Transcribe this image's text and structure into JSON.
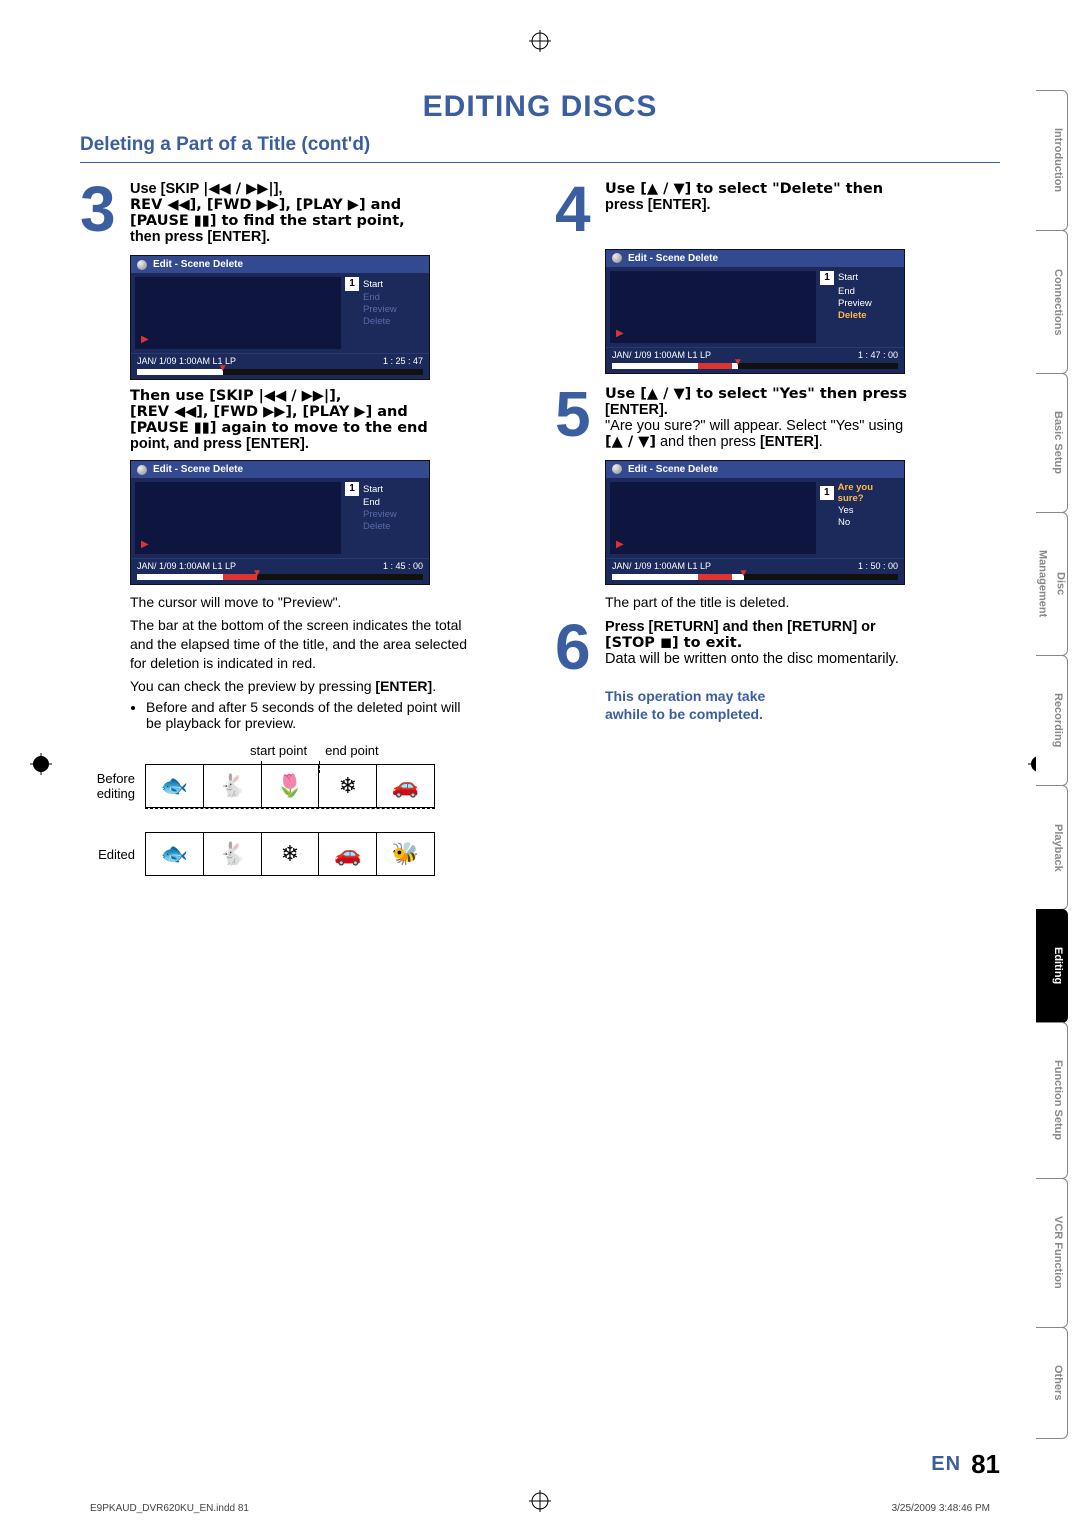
{
  "page_title": "EDITING DISCS",
  "subtitle": "Deleting a Part of a Title (cont'd)",
  "sidebar": {
    "items": [
      {
        "label": "Introduction"
      },
      {
        "label": "Connections"
      },
      {
        "label": "Basic Setup"
      },
      {
        "label_a": "Disc",
        "label_b": "Management"
      },
      {
        "label": "Recording"
      },
      {
        "label": "Playback"
      },
      {
        "label": "Editing"
      },
      {
        "label": "Function Setup"
      },
      {
        "label": "VCR Function"
      },
      {
        "label": "Others"
      }
    ],
    "active_index": 6
  },
  "steps": {
    "s3": {
      "num": "3",
      "line1a": "Use [SKIP ",
      "line1b_icons": "|◀◀ / ▶▶|",
      "line1c": "],",
      "line2": "REV ◀◀], [FWD ▶▶], [PLAY ▶] and",
      "line3": "[PAUSE ▮▮] to find the start point,",
      "line4": "then press [ENTER].",
      "osd1": {
        "header": "Edit - Scene Delete",
        "num": "1",
        "items": [
          {
            "text": "Start",
            "style": "item"
          },
          {
            "text": "End",
            "style": "dim"
          },
          {
            "text": "Preview",
            "style": "dim"
          },
          {
            "text": "Delete",
            "style": "dim"
          }
        ],
        "status": "JAN/ 1/09  1:00AM L1   LP",
        "time": "1 : 25 : 47",
        "fill_pct": 30,
        "arrow_pct": 30
      },
      "then_1": "Then use [SKIP |◀◀ / ▶▶|],",
      "then_2": "[REV ◀◀], [FWD ▶▶], [PLAY ▶] and",
      "then_3": "[PAUSE ▮▮] again to move to the end",
      "then_4": "point, and press [ENTER].",
      "osd2": {
        "header": "Edit - Scene Delete",
        "num": "1",
        "items": [
          {
            "text": "Start",
            "style": "item"
          },
          {
            "text": "End",
            "style": "item"
          },
          {
            "text": "Preview",
            "style": "dim"
          },
          {
            "text": "Delete",
            "style": "dim"
          }
        ],
        "status": "JAN/ 1/09  1:00AM L1   LP",
        "time": "1 : 45 : 00",
        "fill_pct": 42,
        "red_start_pct": 30,
        "red_end_pct": 42,
        "arrow_pct": 42
      },
      "para1": "The cursor will move to \"Preview\".",
      "para2": "The bar at the bottom of the screen indicates the total and the elapsed time of the title, and the area selected for deletion is indicated in red.",
      "para3a": "You can check the preview by pressing ",
      "para3b": "[ENTER]",
      "para3c": ".",
      "bullet": "Before and after 5 seconds of the deleted point will be playback for preview.",
      "diagram": {
        "start_label": "start point",
        "end_label": "end point",
        "before": "Before editing",
        "edited": "Edited"
      }
    },
    "s4": {
      "num": "4",
      "line1": "Use [▲ / ▼] to select \"Delete\" then",
      "line2": "press [ENTER].",
      "osd": {
        "header": "Edit - Scene Delete",
        "num": "1",
        "items": [
          {
            "text": "Start",
            "style": "item"
          },
          {
            "text": "End",
            "style": "item"
          },
          {
            "text": "Preview",
            "style": "item"
          },
          {
            "text": "Delete",
            "style": "hl"
          }
        ],
        "status": "JAN/ 1/09  1:00AM L1   LP",
        "time": "1 : 47 : 00",
        "fill_pct": 44,
        "red_start_pct": 30,
        "red_end_pct": 42,
        "arrow_pct": 44
      }
    },
    "s5": {
      "num": "5",
      "line1": "Use [▲ / ▼] to select \"Yes\" then press",
      "line2": "[ENTER].",
      "para_a": "\"Are you sure?\" will appear. Select \"Yes\" using",
      "para_b": "[▲ / ▼]",
      "para_c": " and then press ",
      "para_d": "[ENTER]",
      "para_e": ".",
      "osd": {
        "header": "Edit - Scene Delete",
        "num": "1",
        "items": [
          {
            "text": "Are you sure?",
            "style": "hl"
          },
          {
            "text": "Yes",
            "style": "item"
          },
          {
            "text": "No",
            "style": "item"
          }
        ],
        "status": "JAN/ 1/09  1:00AM L1   LP",
        "time": "1 : 50 : 00",
        "fill_pct": 46,
        "red_start_pct": 30,
        "red_end_pct": 42,
        "arrow_pct": 46
      },
      "after": "The part of the title is deleted."
    },
    "s6": {
      "num": "6",
      "line1": "Press [RETURN] and then [RETURN] or",
      "line2": "[STOP ◼] to exit.",
      "para": "Data will be written onto the disc momentarily.",
      "note1": "This operation may take",
      "note2": "awhile to be completed."
    }
  },
  "footer": {
    "lang": "EN",
    "page_num": "81"
  },
  "printinfo": {
    "left": "E9PKAUD_DVR620KU_EN.indd   81",
    "right": "3/25/2009   3:48:46 PM"
  }
}
